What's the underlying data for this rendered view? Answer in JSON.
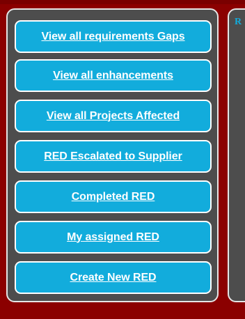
{
  "nav": {
    "buttons": [
      {
        "label": "View all requirements Gaps"
      },
      {
        "label": "View all enhancements"
      },
      {
        "label": "View all Projects Affected"
      },
      {
        "label": "RED Escalated to Supplier"
      },
      {
        "label": "Completed RED"
      },
      {
        "label": "My assigned RED"
      },
      {
        "label": "Create New RED"
      }
    ]
  },
  "content_panel": {
    "title": "R"
  },
  "colors": {
    "page_background": "#8b0000",
    "panel_background": "#4d4d4d",
    "button_background": "#12acdc",
    "button_text": "#ffffff",
    "panel_border": "#e6e6e6"
  }
}
